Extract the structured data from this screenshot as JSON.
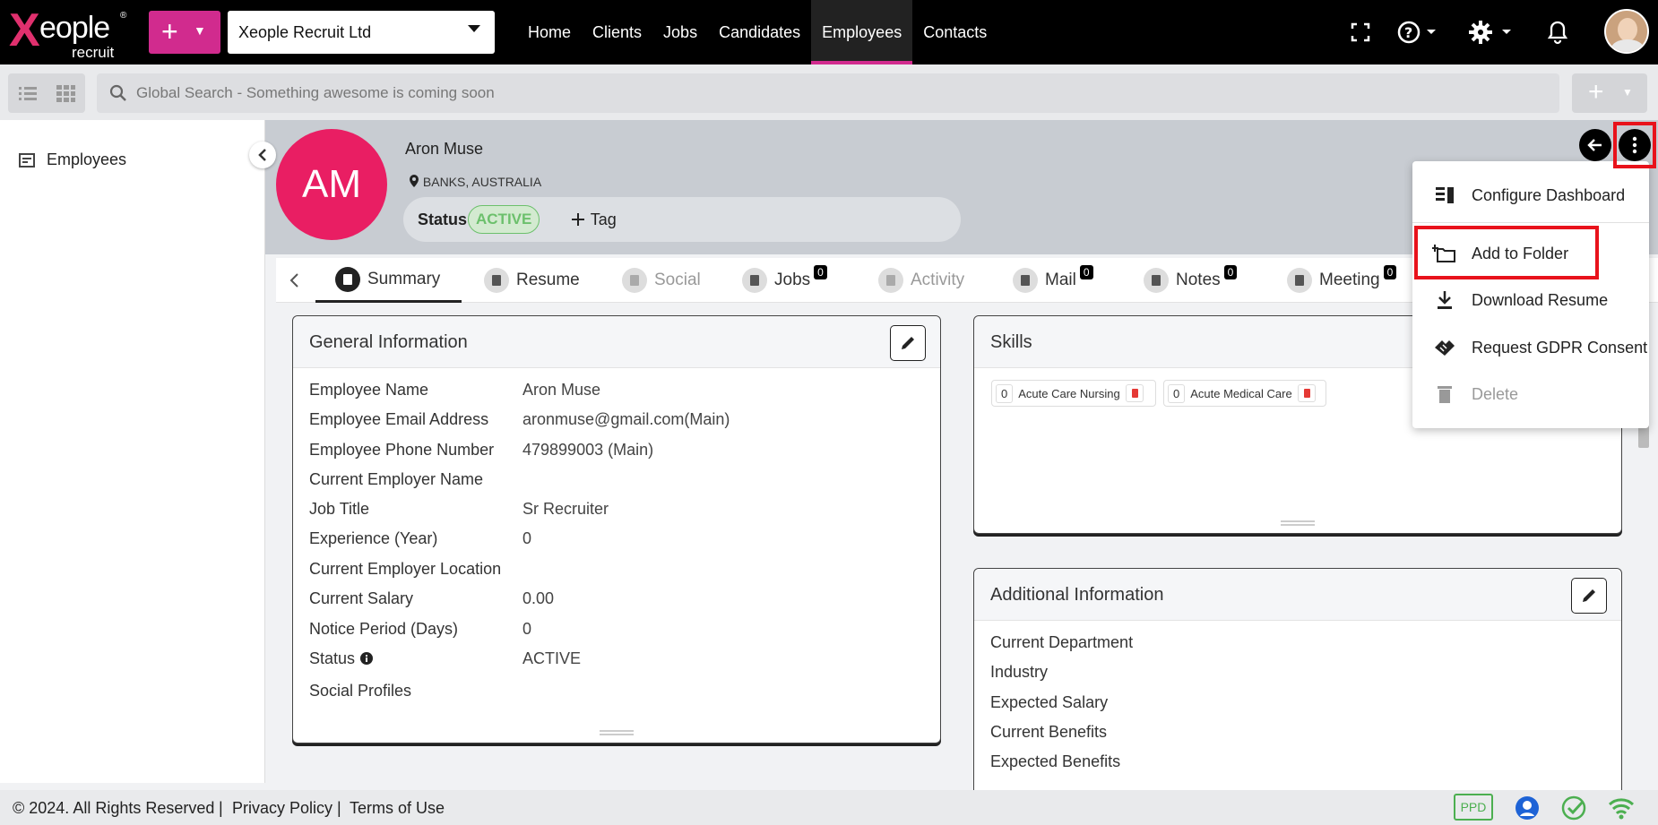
{
  "app": {
    "logo_word": "eople",
    "logo_sub": "recruit",
    "company": "Xeople Recruit Ltd"
  },
  "nav": [
    "Home",
    "Clients",
    "Jobs",
    "Candidates",
    "Employees",
    "Contacts"
  ],
  "nav_active": "Employees",
  "search": {
    "placeholder": "Global Search - Something awesome is coming soon"
  },
  "sidebar": {
    "item": "Employees"
  },
  "profile": {
    "initials": "AM",
    "name": "Aron Muse",
    "location": "BANKS, AUSTRALIA",
    "status_label": "Status",
    "status_value": "ACTIVE",
    "tag_label": "Tag"
  },
  "tabs": [
    {
      "label": "Summary",
      "count": null,
      "state": "active"
    },
    {
      "label": "Resume",
      "count": null,
      "state": "normal"
    },
    {
      "label": "Social",
      "count": null,
      "state": "disabled"
    },
    {
      "label": "Jobs",
      "count": "0",
      "state": "normal"
    },
    {
      "label": "Activity",
      "count": null,
      "state": "disabled"
    },
    {
      "label": "Mail",
      "count": "0",
      "state": "normal"
    },
    {
      "label": "Notes",
      "count": "0",
      "state": "normal"
    },
    {
      "label": "Meeting",
      "count": "0",
      "state": "normal"
    }
  ],
  "general": {
    "title": "General Information",
    "rows": [
      {
        "k": "Employee Name",
        "v": "Aron Muse"
      },
      {
        "k": "Employee Email Address",
        "v": "aronmuse@gmail.com(Main)"
      },
      {
        "k": "Employee Phone Number",
        "v": "479899003 (Main)"
      },
      {
        "k": "Current Employer Name",
        "v": ""
      },
      {
        "k": "Job Title",
        "v": "Sr Recruiter"
      },
      {
        "k": "Experience (Year)",
        "v": "0"
      },
      {
        "k": "Current Employer Location",
        "v": ""
      },
      {
        "k": "Current Salary",
        "v": "0.00"
      },
      {
        "k": "Notice Period (Days)",
        "v": "0"
      },
      {
        "k": "Status",
        "v": "ACTIVE"
      },
      {
        "k": "Social Profiles",
        "v": ""
      }
    ]
  },
  "skills": {
    "title": "Skills",
    "items": [
      {
        "count": "0",
        "label": "Acute Care Nursing"
      },
      {
        "count": "0",
        "label": "Acute Medical Care"
      }
    ]
  },
  "additional": {
    "title": "Additional Information",
    "rows": [
      "Current Department",
      "Industry",
      "Expected Salary",
      "Current Benefits",
      "Expected Benefits"
    ]
  },
  "menu": {
    "items": [
      {
        "label": "Configure Dashboard",
        "icon": "dashboard-config-icon",
        "glyph": "▤",
        "disabled": false
      },
      {
        "label": "Add to Folder",
        "icon": "add-folder-icon",
        "glyph": "🗀",
        "disabled": false
      },
      {
        "label": "Download Resume",
        "icon": "download-icon",
        "glyph": "⭳",
        "disabled": false
      },
      {
        "label": "Request GDPR Consent",
        "icon": "handshake-icon",
        "glyph": "✋",
        "disabled": false
      },
      {
        "label": "Delete",
        "icon": "trash-icon",
        "glyph": "🗑",
        "disabled": true
      }
    ]
  },
  "footer": {
    "copyright": "© 2024. All Rights Reserved",
    "sep1": "|",
    "privacy": "Privacy Policy",
    "sep2": "|",
    "terms": "Terms of Use",
    "ppd": "PPD"
  },
  "colors": {
    "brand": "#d12b8e",
    "avatar": "#e91e63",
    "active_green": "#6cc06c",
    "highlight": "#e8121b"
  }
}
